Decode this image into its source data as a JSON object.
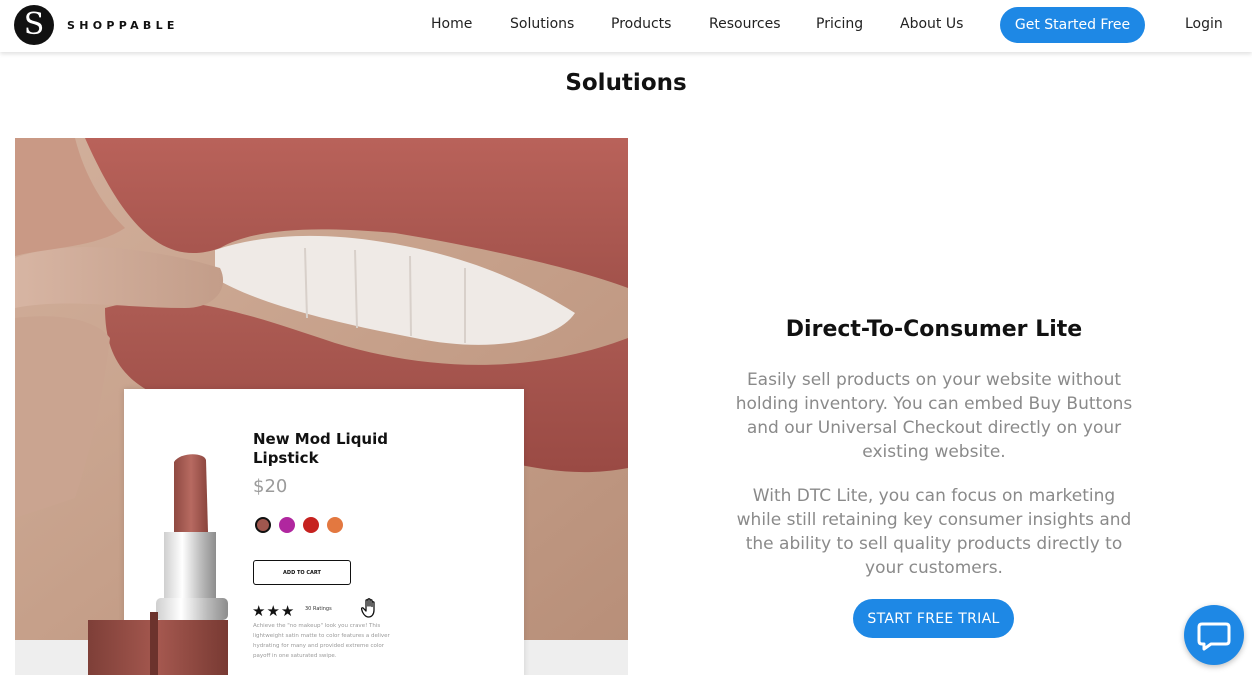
{
  "header": {
    "logo_letter": "S",
    "brand": "SHOPPABLE",
    "nav": [
      "Home",
      "Solutions",
      "Products",
      "Resources",
      "Pricing",
      "About Us"
    ],
    "cta_label": "Get Started Free",
    "login_label": "Login"
  },
  "page_title": "Solutions",
  "product_card": {
    "title": "New Mod Liquid Lipstick",
    "price": "$20",
    "swatches": [
      "#a0574e",
      "#b0279f",
      "#c6211f",
      "#e37840"
    ],
    "add_to_cart": "ADD TO CART",
    "stars": "★★★",
    "ratings": "30 Ratings",
    "description": "Achieve the \"no makeup\" look you crave! This lightweight satin matte to color features a deliver hydrating for many and provided extreme color payoff in one saturated swipe."
  },
  "section": {
    "title": "Direct-To-Consumer Lite",
    "paragraphs": [
      "Easily sell products on your website without holding inventory. You can embed Buy Buttons and our Universal Checkout directly on your existing website.",
      "With DTC Lite, you can focus on marketing while still retaining key consumer insights and the ability to sell quality products directly to your customers."
    ],
    "button_label": "START FREE TRIAL"
  },
  "colors": {
    "accent": "#1e88e5",
    "lip": "#ad5c54",
    "text_muted": "#8a8a8a"
  },
  "icons": {
    "logo": "shoppable-s-logo",
    "hand": "hand-pointer-icon",
    "chat": "chat-bubble-icon"
  }
}
